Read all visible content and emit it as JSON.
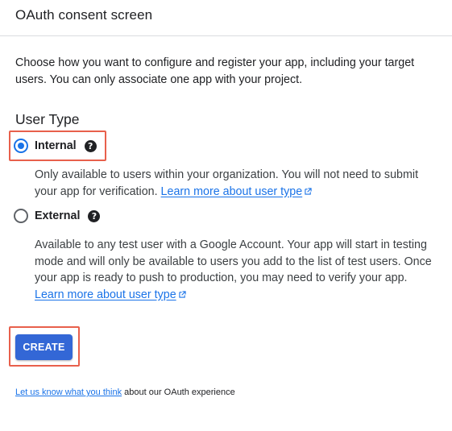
{
  "header": {
    "title": "OAuth consent screen"
  },
  "intro_text": "Choose how you want to configure and register your app, including your target users. You can only associate one app with your project.",
  "user_type": {
    "heading": "User Type",
    "options": [
      {
        "label": "Internal",
        "selected": true,
        "description": "Only available to users within your organization. You will not need to submit your app for verification.",
        "link_text": "Learn more about user type"
      },
      {
        "label": "External",
        "selected": false,
        "description": "Available to any test user with a Google Account. Your app will start in testing mode and will only be available to users you add to the list of test users. Once your app is ready to push to production, you may need to verify your app.",
        "link_text": "Learn more about user type"
      }
    ]
  },
  "create_button_label": "CREATE",
  "feedback": {
    "link_text": "Let us know what you think",
    "suffix_text": " about our OAuth experience"
  },
  "colors": {
    "accent": "#1a73e8",
    "button": "#3367d6",
    "highlight": "#e8604c"
  },
  "icons": [
    "help-icon",
    "external-link-icon"
  ]
}
